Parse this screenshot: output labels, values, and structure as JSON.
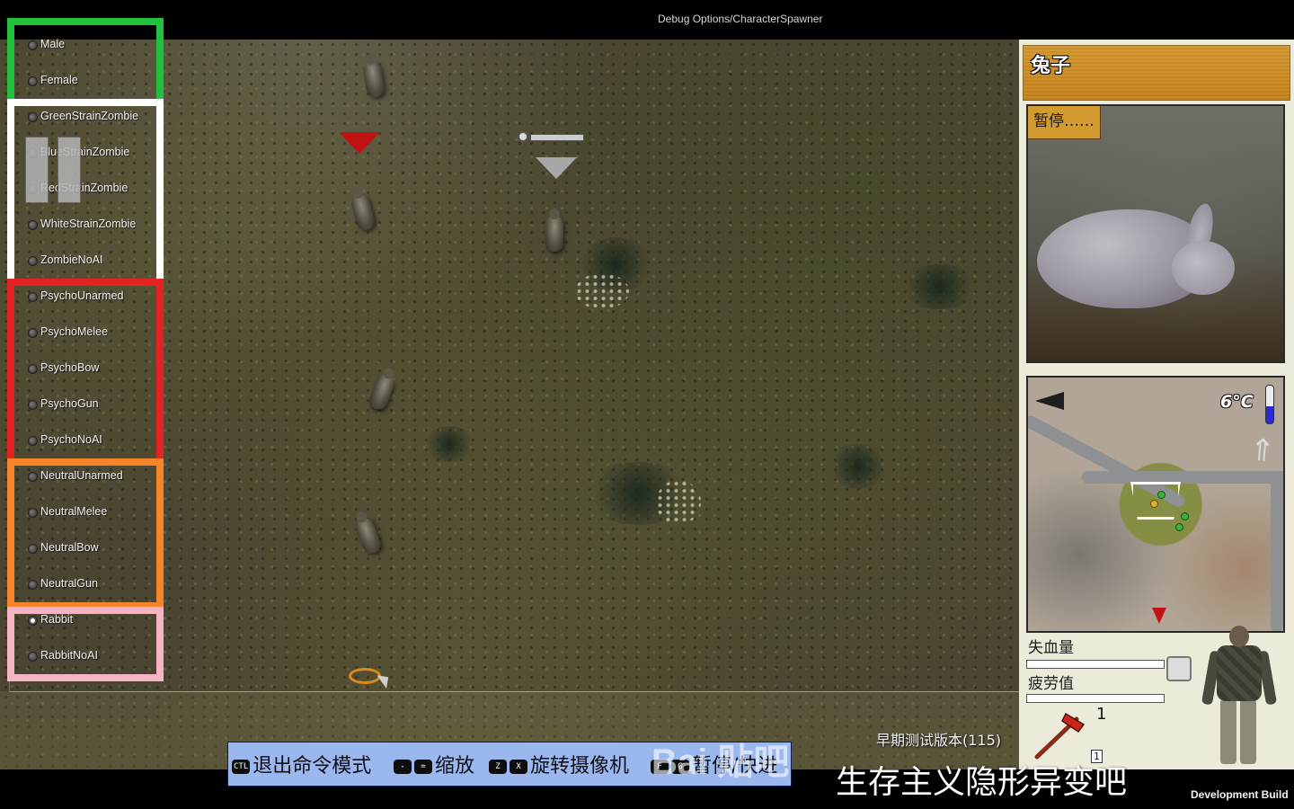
{
  "window": {
    "title": "Debug Options/CharacterSpawner"
  },
  "spawner": {
    "groups": [
      {
        "id": "gender",
        "color": "#1fc23a",
        "options": [
          "Male",
          "Female"
        ]
      },
      {
        "id": "zombies",
        "color": "#ffffff",
        "options": [
          "GreenStrainZombie",
          "BlueStrainZombie",
          "RedStrainZombie",
          "WhiteStrainZombie",
          "ZombieNoAI"
        ]
      },
      {
        "id": "psychos",
        "color": "#e52222",
        "options": [
          "PsychoUnarmed",
          "PsychoMelee",
          "PsychoBow",
          "PsychoGun",
          "PsychoNoAI"
        ]
      },
      {
        "id": "neutrals",
        "color": "#f5842a",
        "options": [
          "NeutralUnarmed",
          "NeutralMelee",
          "NeutralBow",
          "NeutralGun"
        ]
      },
      {
        "id": "rabbits",
        "color": "#f7b4c4",
        "options": [
          "Rabbit",
          "RabbitNoAI"
        ]
      }
    ],
    "selected": "Rabbit"
  },
  "subject": {
    "name": "兔子",
    "paused_label": "暂停……"
  },
  "minimap": {
    "temperature": "6°C"
  },
  "stats": {
    "blood_loss_label": "失血量",
    "blood_loss_fill": 0.0,
    "fatigue_label": "疲劳值",
    "fatigue_fill": 0.0
  },
  "inventory": {
    "weapon_icon": "axe-icon",
    "count": "1",
    "slot": "1"
  },
  "hints": [
    {
      "keys": [
        "CTL"
      ],
      "label": "退出命令模式"
    },
    {
      "keys": [
        "-",
        "="
      ],
      "label": "缩放"
    },
    {
      "keys": [
        "Z",
        "X"
      ],
      "label": "旋转摄像机"
    },
    {
      "keys": [
        "F",
        "G"
      ],
      "label": "暂停/快进"
    }
  ],
  "build_version": "早期测试版本(115)",
  "watermark": "Bai 贴吧",
  "community": "生存主义隐形异变吧",
  "dev_build": "Development Build",
  "colors": {
    "accent_orange": "#d79b34",
    "hint_bar": "#9ab7ee",
    "enemy_marker": "#c21313"
  }
}
